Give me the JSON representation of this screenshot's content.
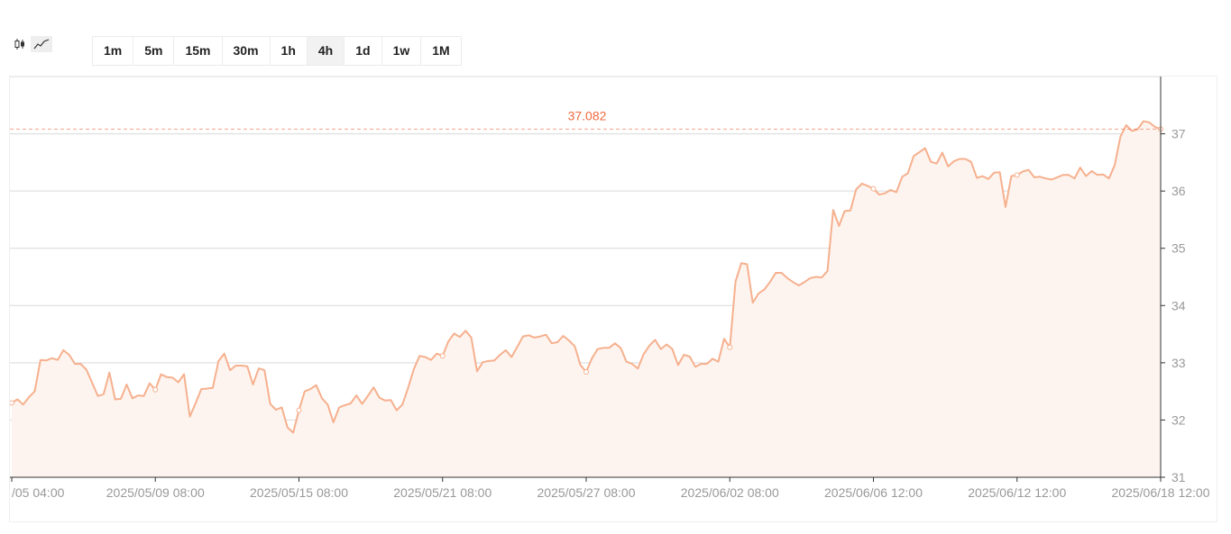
{
  "toolbar": {
    "chart_types": [
      {
        "name": "candlestick-icon",
        "active": false
      },
      {
        "name": "line-chart-icon",
        "active": true
      }
    ],
    "intervals": [
      "1m",
      "5m",
      "15m",
      "30m",
      "1h",
      "4h",
      "1d",
      "1w",
      "1M"
    ],
    "active_interval": "4h"
  },
  "colors": {
    "line": "#f6b08e",
    "area": "#fdf4ef",
    "last_price": "#f06a40",
    "grid": "#d9d9d9",
    "axis_text": "#999999"
  },
  "chart_data": {
    "type": "area",
    "last_price_label": "37.082",
    "ylim": [
      31,
      38
    ],
    "y_ticks": [
      "31",
      "32",
      "33",
      "34",
      "35",
      "36",
      "37"
    ],
    "x_tick_labels": [
      "/05 04:00",
      "2025/05/09 08:00",
      "2025/05/15 08:00",
      "2025/05/21 08:00",
      "2025/05/27 08:00",
      "2025/06/02 08:00",
      "2025/06/06 12:00",
      "2025/06/12 12:00",
      "2025/06/18 12:00"
    ],
    "x_tick_index": [
      0,
      25,
      50,
      75,
      100,
      125,
      150,
      175,
      200
    ],
    "marker_index": [
      0,
      25,
      50,
      75,
      100,
      125,
      150,
      175,
      200
    ],
    "values": [
      32.3,
      32.36,
      32.27,
      32.4,
      32.5,
      33.05,
      33.04,
      33.08,
      33.05,
      33.22,
      33.14,
      32.98,
      32.98,
      32.88,
      32.65,
      32.42,
      32.45,
      32.83,
      32.36,
      32.37,
      32.62,
      32.38,
      32.43,
      32.42,
      32.64,
      32.53,
      32.8,
      32.75,
      32.74,
      32.66,
      32.8,
      32.06,
      32.29,
      32.54,
      32.55,
      32.56,
      33.03,
      33.16,
      32.87,
      32.95,
      32.95,
      32.94,
      32.62,
      32.9,
      32.87,
      32.28,
      32.18,
      32.22,
      31.87,
      31.78,
      32.17,
      32.5,
      32.54,
      32.61,
      32.38,
      32.27,
      31.96,
      32.22,
      32.26,
      32.29,
      32.43,
      32.28,
      32.42,
      32.57,
      32.39,
      32.34,
      32.35,
      32.17,
      32.27,
      32.56,
      32.89,
      33.12,
      33.1,
      33.05,
      33.16,
      33.12,
      33.37,
      33.51,
      33.45,
      33.56,
      33.44,
      32.85,
      33.01,
      33.03,
      33.04,
      33.14,
      33.22,
      33.1,
      33.28,
      33.46,
      33.48,
      33.44,
      33.46,
      33.49,
      33.34,
      33.36,
      33.47,
      33.39,
      33.29,
      32.96,
      32.84,
      33.08,
      33.24,
      33.26,
      33.26,
      33.34,
      33.26,
      33.02,
      32.98,
      32.9,
      33.15,
      33.3,
      33.4,
      33.24,
      33.32,
      33.24,
      32.96,
      33.14,
      33.11,
      32.93,
      32.98,
      32.98,
      33.07,
      33.02,
      33.42,
      33.27,
      34.42,
      34.74,
      34.72,
      34.05,
      34.21,
      34.28,
      34.41,
      34.57,
      34.57,
      34.48,
      34.41,
      34.35,
      34.41,
      34.48,
      34.5,
      34.49,
      34.6,
      35.67,
      35.39,
      35.65,
      35.66,
      36.03,
      36.13,
      36.09,
      36.04,
      35.94,
      35.96,
      36.02,
      35.98,
      36.25,
      36.31,
      36.61,
      36.68,
      36.75,
      36.51,
      36.48,
      36.67,
      36.43,
      36.52,
      36.56,
      36.56,
      36.51,
      36.23,
      36.26,
      36.21,
      36.32,
      36.33,
      35.72,
      36.26,
      36.28,
      36.34,
      36.37,
      36.24,
      36.25,
      36.22,
      36.2,
      36.24,
      36.28,
      36.28,
      36.22,
      36.41,
      36.26,
      36.35,
      36.28,
      36.29,
      36.22,
      36.45,
      36.95,
      37.15,
      37.05,
      37.08,
      37.22,
      37.2,
      37.12,
      37.082
    ]
  }
}
